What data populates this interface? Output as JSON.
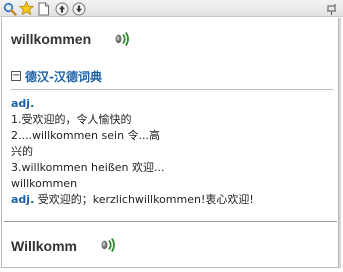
{
  "toolbar": {
    "buttons": [
      "search-icon",
      "favorite-star-icon",
      "page-icon",
      "arrow-up-icon",
      "arrow-down-icon"
    ],
    "pin": "pin-icon"
  },
  "entry": {
    "word": "willkommen",
    "speaker_icon": "speaker-icon"
  },
  "dictionary": {
    "collapse_symbol": "−",
    "title": "德汉-汉德词典",
    "definition_lines": [
      {
        "pos": "adj.",
        "text": ""
      },
      {
        "pos": "",
        "text": "1.受欢迎的，令人愉快的"
      },
      {
        "pos": "",
        "text": "2....willkommen sein 令...高"
      },
      {
        "pos": "",
        "text": "兴的"
      },
      {
        "pos": "",
        "text": "3.willkommen heißen 欢迎..."
      },
      {
        "pos": "",
        "text": "willkommen"
      },
      {
        "pos": "adj.",
        "text": " 受欢迎的；kerzlichwillkommen!衷心欢迎!"
      }
    ]
  },
  "next_entry": {
    "word": "Willkomm",
    "speaker_icon": "speaker-icon"
  },
  "colors": {
    "accent": "#1c61a8",
    "separator": "#9a9a9a"
  }
}
